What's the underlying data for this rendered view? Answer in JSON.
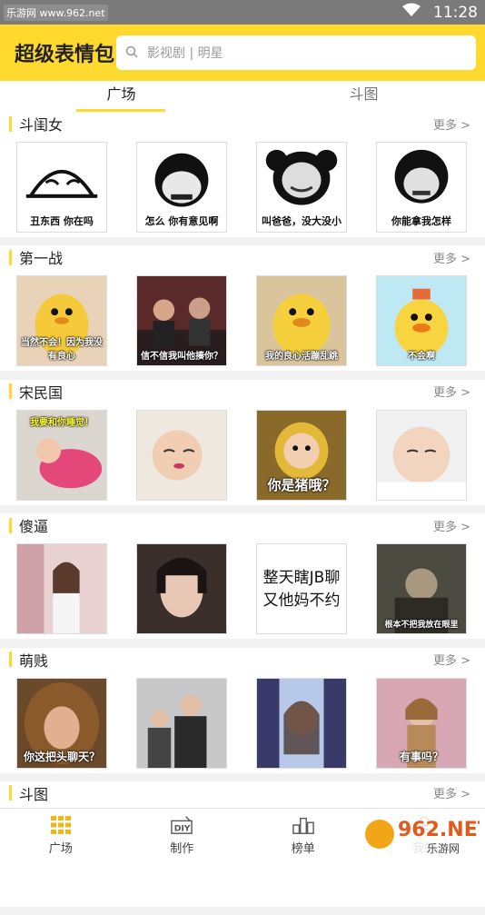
{
  "status_bar": {
    "watermark": "乐游网 www.962.net",
    "time": "11:28"
  },
  "header": {
    "title": "超级表情包",
    "search_placeholder": "影视剧 | 明星"
  },
  "tabs": [
    {
      "label": "广场",
      "active": true
    },
    {
      "label": "斗图",
      "active": false
    }
  ],
  "more_label": "更多 >",
  "sections": [
    {
      "title": "斗闺女",
      "captions": [
        "丑东西 你在吗",
        "怎么 你有意见啊",
        "叫爸爸，没大没小",
        "你能拿我怎样"
      ]
    },
    {
      "title": "第一战",
      "captions": [
        "当然不会！因为我没有良心",
        "信不信我叫他揍你？",
        "我的良心活蹦乱跳",
        "不会啊"
      ]
    },
    {
      "title": "宋民国",
      "captions": [
        "我要和你睡觉！",
        "",
        "你是猪哦？",
        ""
      ]
    },
    {
      "title": "傻逼",
      "captions": [
        "",
        "",
        "整天瞎JB聊 又他妈不约",
        "根本不把我放在眼里"
      ]
    },
    {
      "title": "萌贱",
      "captions": [
        "你这把头聊天？",
        "",
        "",
        "有事吗？"
      ]
    },
    {
      "title": "斗图",
      "captions": []
    }
  ],
  "bottom_nav": [
    {
      "label": "广场",
      "icon": "grid-icon"
    },
    {
      "label": "制作",
      "icon": "diy-icon"
    },
    {
      "label": "榜单",
      "icon": "podium-icon"
    },
    {
      "label": "我的",
      "icon": "user-icon"
    }
  ],
  "logo_watermark": {
    "brand": "962.NET",
    "sub": "乐游网"
  },
  "colors": {
    "accent": "#ffd92e",
    "status_bar": "#7a7a7a"
  }
}
